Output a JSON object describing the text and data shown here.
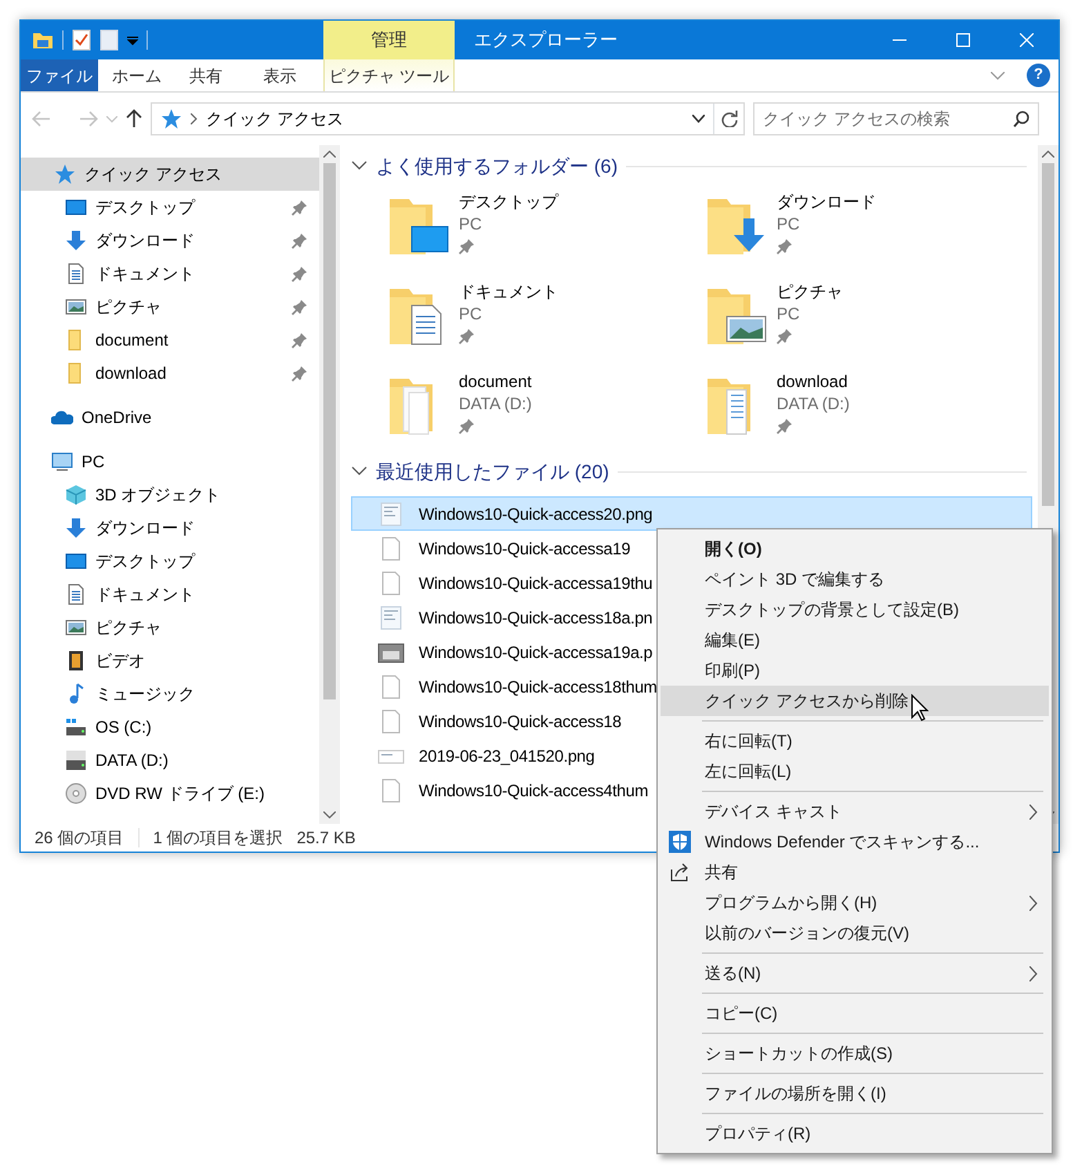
{
  "window": {
    "title": "エクスプローラー",
    "context_group": "管理"
  },
  "ribbon": {
    "tabs": [
      {
        "label": "ファイル",
        "kind": "file"
      },
      {
        "label": "ホーム",
        "kind": "normal"
      },
      {
        "label": "共有",
        "kind": "normal"
      },
      {
        "label": "表示",
        "kind": "normal"
      },
      {
        "label": "ピクチャ ツール",
        "kind": "contextual"
      }
    ],
    "help": "?"
  },
  "navigation": {
    "back": {
      "disabled": true
    },
    "forward": {
      "disabled": true
    },
    "up": {
      "disabled": false
    }
  },
  "address_bar": {
    "path": "クイック アクセス"
  },
  "search": {
    "placeholder": "クイック アクセスの検索"
  },
  "sidebar": {
    "items": [
      {
        "label": "クイック アクセス",
        "kind": "star",
        "selected": true,
        "children": [
          {
            "label": "デスクトップ",
            "kind": "desktop",
            "pinned": true,
            "selected": false
          },
          {
            "label": "ダウンロード",
            "kind": "download",
            "pinned": true,
            "selected": false
          },
          {
            "label": "ドキュメント",
            "kind": "documents",
            "pinned": true,
            "selected": false
          },
          {
            "label": "ピクチャ",
            "kind": "pictures",
            "pinned": true,
            "selected": false
          },
          {
            "label": "document",
            "kind": "folder",
            "pinned": true,
            "selected": false
          },
          {
            "label": "download",
            "kind": "folder",
            "pinned": true,
            "selected": false
          }
        ]
      },
      {
        "label": "OneDrive",
        "kind": "onedrive",
        "selected": false
      },
      {
        "label": "PC",
        "kind": "pc",
        "selected": false,
        "children": [
          {
            "label": "3D オブジェクト",
            "kind": "objects3d",
            "pinned": false,
            "selected": false
          },
          {
            "label": "ダウンロード",
            "kind": "download",
            "pinned": false,
            "selected": false
          },
          {
            "label": "デスクトップ",
            "kind": "desktop",
            "pinned": false,
            "selected": false
          },
          {
            "label": "ドキュメント",
            "kind": "documents",
            "pinned": false,
            "selected": false
          },
          {
            "label": "ピクチャ",
            "kind": "pictures",
            "pinned": false,
            "selected": false
          },
          {
            "label": "ビデオ",
            "kind": "video",
            "pinned": false,
            "selected": false
          },
          {
            "label": "ミュージック",
            "kind": "music",
            "pinned": false,
            "selected": false
          },
          {
            "label": "OS (C:)",
            "kind": "os-drive",
            "pinned": false,
            "selected": false
          },
          {
            "label": "DATA (D:)",
            "kind": "data-drive",
            "pinned": false,
            "selected": false
          },
          {
            "label": "DVD RW ドライブ (E:)",
            "kind": "dvd",
            "pinned": false,
            "selected": false
          }
        ]
      }
    ]
  },
  "frequent_folders": {
    "title": "よく使用するフォルダー (6)",
    "expanded": true,
    "items": [
      {
        "name": "デスクトップ",
        "location": "PC",
        "kind": "desktop",
        "pinned": true
      },
      {
        "name": "ダウンロード",
        "location": "PC",
        "kind": "download",
        "pinned": true
      },
      {
        "name": "ドキュメント",
        "location": "PC",
        "kind": "documents",
        "pinned": true
      },
      {
        "name": "ピクチャ",
        "location": "PC",
        "kind": "pictures",
        "pinned": true
      },
      {
        "name": "document",
        "location": "DATA (D:)",
        "kind": "papers",
        "pinned": true
      },
      {
        "name": "download",
        "location": "DATA (D:)",
        "kind": "files",
        "pinned": true
      }
    ]
  },
  "recent_files": {
    "title": "最近使用したファイル (20)",
    "expanded": true,
    "items": [
      {
        "name": "Windows10-Quick-access20.png",
        "kind": "thumbnail",
        "selected": true
      },
      {
        "name": "Windows10-Quick-accessa19",
        "kind": "blank",
        "selected": false
      },
      {
        "name": "Windows10-Quick-accessa19thu",
        "kind": "blank",
        "selected": false
      },
      {
        "name": "Windows10-Quick-access18a.pn",
        "kind": "thumbnail",
        "selected": false
      },
      {
        "name": "Windows10-Quick-accessa19a.p",
        "kind": "dark-thumbnail",
        "selected": false
      },
      {
        "name": "Windows10-Quick-access18thum",
        "kind": "blank",
        "selected": false
      },
      {
        "name": "Windows10-Quick-access18",
        "kind": "blank",
        "selected": false
      },
      {
        "name": "2019-06-23_041520.png",
        "kind": "wide-thumbnail",
        "selected": false
      },
      {
        "name": "Windows10-Quick-access4thum",
        "kind": "blank",
        "selected": false
      }
    ]
  },
  "status_bar": {
    "item_count": "26 個の項目",
    "selection": "1 個の項目を選択",
    "size": "25.7 KB"
  },
  "context_menu": {
    "items": [
      {
        "kind": "command",
        "label": "開く(O)",
        "default": true,
        "selected": false,
        "submenu": false
      },
      {
        "kind": "command",
        "label": "ペイント 3D で編集する",
        "default": false,
        "selected": false,
        "submenu": false
      },
      {
        "kind": "command",
        "label": "デスクトップの背景として設定(B)",
        "default": false,
        "selected": false,
        "submenu": false
      },
      {
        "kind": "command",
        "label": "編集(E)",
        "default": false,
        "selected": false,
        "submenu": false
      },
      {
        "kind": "command",
        "label": "印刷(P)",
        "default": false,
        "selected": false,
        "submenu": false
      },
      {
        "kind": "command",
        "label": "クイック アクセスから削除",
        "default": false,
        "selected": true,
        "submenu": false
      },
      {
        "kind": "separator"
      },
      {
        "kind": "command",
        "label": "右に回転(T)",
        "default": false,
        "selected": false,
        "submenu": false
      },
      {
        "kind": "command",
        "label": "左に回転(L)",
        "default": false,
        "selected": false,
        "submenu": false
      },
      {
        "kind": "separator"
      },
      {
        "kind": "command",
        "label": "デバイス キャスト",
        "default": false,
        "selected": false,
        "submenu": true
      },
      {
        "kind": "shield",
        "label": "Windows Defender でスキャンする...",
        "default": false,
        "selected": false,
        "submenu": false
      },
      {
        "kind": "share",
        "label": "共有",
        "default": false,
        "selected": false,
        "submenu": false
      },
      {
        "kind": "command",
        "label": "プログラムから開く(H)",
        "default": false,
        "selected": false,
        "submenu": true
      },
      {
        "kind": "command",
        "label": "以前のバージョンの復元(V)",
        "default": false,
        "selected": false,
        "submenu": false
      },
      {
        "kind": "separator"
      },
      {
        "kind": "command",
        "label": "送る(N)",
        "default": false,
        "selected": false,
        "submenu": true
      },
      {
        "kind": "separator"
      },
      {
        "kind": "command",
        "label": "コピー(C)",
        "default": false,
        "selected": false,
        "submenu": false
      },
      {
        "kind": "separator"
      },
      {
        "kind": "command",
        "label": "ショートカットの作成(S)",
        "default": false,
        "selected": false,
        "submenu": false
      },
      {
        "kind": "separator"
      },
      {
        "kind": "command",
        "label": "ファイルの場所を開く(I)",
        "default": false,
        "selected": false,
        "submenu": false
      },
      {
        "kind": "separator"
      },
      {
        "kind": "command",
        "label": "プロパティ(R)",
        "default": false,
        "selected": false,
        "submenu": false
      }
    ]
  }
}
